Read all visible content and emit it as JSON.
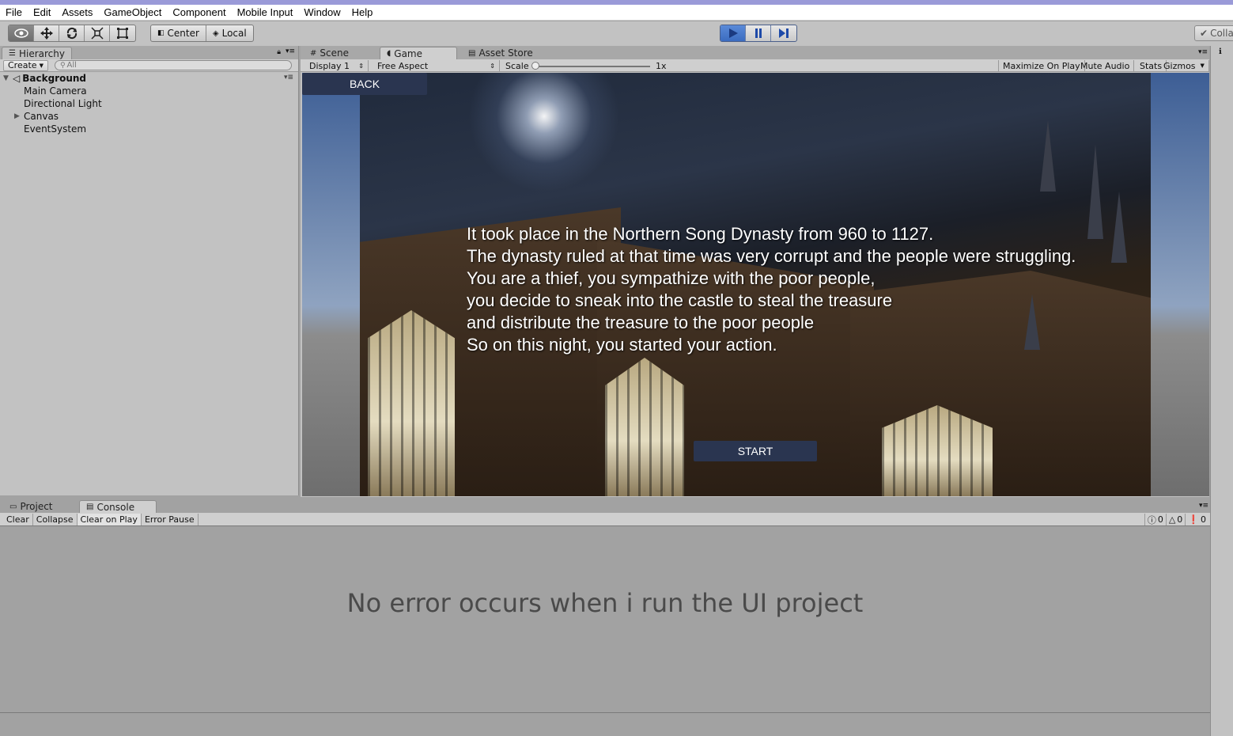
{
  "menu": [
    "File",
    "Edit",
    "Assets",
    "GameObject",
    "Component",
    "Mobile Input",
    "Window",
    "Help"
  ],
  "toolbar": {
    "pivot_label": "Center",
    "space_label": "Local",
    "collab_label": "Colla"
  },
  "hierarchy": {
    "tab_label": "Hierarchy",
    "create_label": "Create",
    "search_placeholder": "All",
    "scene_name": "Background",
    "items": [
      {
        "label": "Main Camera"
      },
      {
        "label": "Directional Light"
      },
      {
        "label": "Canvas"
      },
      {
        "label": "EventSystem"
      }
    ]
  },
  "view_tabs": {
    "scene": "Scene",
    "game": "Game",
    "asset_store": "Asset Store"
  },
  "game_toolbar": {
    "display": "Display 1",
    "aspect": "Free Aspect",
    "scale_label": "Scale",
    "scale_value": "1x",
    "maximize": "Maximize On Play",
    "mute": "Mute Audio",
    "stats": "Stats",
    "gizmos": "Gizmos"
  },
  "game_ui": {
    "back_label": "BACK",
    "start_label": "START",
    "story_lines": [
      "It took place in the Northern Song Dynasty from 960 to 1127.",
      "The dynasty ruled at that time was very corrupt and the people were struggling.",
      "You are a thief, you sympathize with the poor people,",
      "you decide to sneak into the castle to steal the treasure",
      "and distribute the treasure to the poor people",
      "So on this night, you started your action."
    ]
  },
  "console": {
    "tab_project": "Project",
    "tab_console": "Console",
    "clear": "Clear",
    "collapse": "Collapse",
    "clear_on_play": "Clear on Play",
    "error_pause": "Error Pause",
    "log_count": "0",
    "warning_count": "0",
    "error_count": "0",
    "note": "No error occurs when i run the UI project"
  },
  "colors": {
    "play_active": "#3b6cc0",
    "panel": "#c2c2c2",
    "ui_button": "#2a3550"
  }
}
